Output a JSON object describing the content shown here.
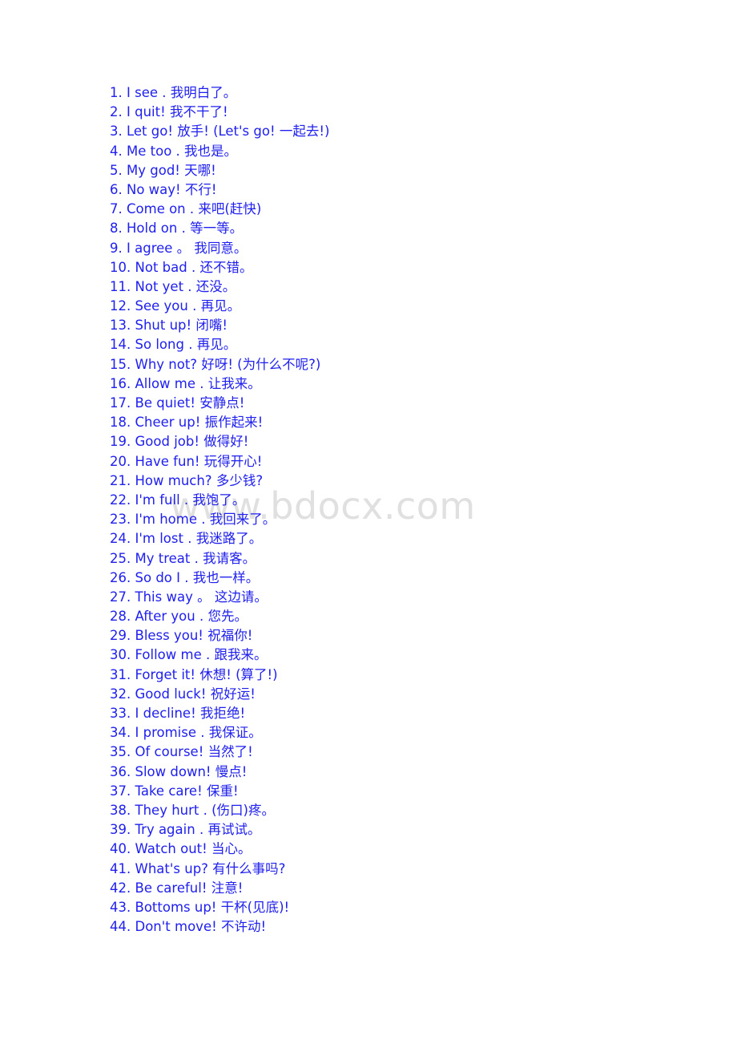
{
  "document": {
    "background_color": "#ffffff",
    "text_color": "#2020ee",
    "watermark": {
      "text": "www.bdocx.com",
      "color": "#e0e0e0"
    }
  },
  "phrases": [
    {
      "num": "1.",
      "en": "I see",
      "sep": ".",
      "zh": "我明白了。"
    },
    {
      "num": "2.",
      "en": "I quit!",
      "sep": "",
      "zh": "我不干了!"
    },
    {
      "num": "3.",
      "en": "Let go!",
      "sep": "",
      "zh": "放手!  (Let's go! 一起去!)"
    },
    {
      "num": "4.",
      "en": "Me too",
      "sep": ".",
      "zh": "我也是。"
    },
    {
      "num": "5.",
      "en": "My god!",
      "sep": "",
      "zh": "天哪!"
    },
    {
      "num": "6.",
      "en": "No way!",
      "sep": "",
      "zh": "不行!"
    },
    {
      "num": "7.",
      "en": "Come on",
      "sep": ".",
      "zh": "来吧(赶快)"
    },
    {
      "num": "8.",
      "en": "Hold on",
      "sep": ".",
      "zh": "等一等。"
    },
    {
      "num": "9.",
      "en": "I agree",
      "sep": "。",
      "zh": "我同意。"
    },
    {
      "num": "10.",
      "en": "Not bad",
      "sep": ".",
      "zh": "还不错。"
    },
    {
      "num": "11.",
      "en": "Not yet",
      "sep": ".",
      "zh": "还没。"
    },
    {
      "num": "12.",
      "en": "See you",
      "sep": ".",
      "zh": "再见。"
    },
    {
      "num": "13.",
      "en": "Shut up!",
      "sep": "",
      "zh": "闭嘴!"
    },
    {
      "num": "14.",
      "en": "So long",
      "sep": ".",
      "zh": "再见。"
    },
    {
      "num": "15.",
      "en": "Why not?",
      "sep": "",
      "zh": "好呀! (为什么不呢?)"
    },
    {
      "num": "16.",
      "en": "Allow me",
      "sep": ".",
      "zh": "让我来。"
    },
    {
      "num": "17.",
      "en": "Be quiet!",
      "sep": "",
      "zh": "安静点!"
    },
    {
      "num": "18.",
      "en": "Cheer up!",
      "sep": "",
      "zh": "振作起来!"
    },
    {
      "num": "19.",
      "en": "Good job!",
      "sep": "",
      "zh": "做得好!"
    },
    {
      "num": "20.",
      "en": "Have fun!",
      "sep": "",
      "zh": "玩得开心!"
    },
    {
      "num": "21.",
      "en": "How much?",
      "sep": "",
      "zh": "多少钱?"
    },
    {
      "num": "22.",
      "en": "I'm full",
      "sep": ".",
      "zh": "我饱了。"
    },
    {
      "num": "23.",
      "en": "I'm home",
      "sep": ".",
      "zh": "我回来了。"
    },
    {
      "num": "24.",
      "en": "I'm lost",
      "sep": ".",
      "zh": "我迷路了。"
    },
    {
      "num": "25.",
      "en": "My treat",
      "sep": ".",
      "zh": "我请客。"
    },
    {
      "num": "26.",
      "en": "So do I",
      "sep": ".",
      "zh": "我也一样。"
    },
    {
      "num": "27.",
      "en": "This way",
      "sep": "。",
      "zh": "这边请。"
    },
    {
      "num": "28.",
      "en": "After you",
      "sep": ".",
      "zh": "您先。"
    },
    {
      "num": "29.",
      "en": "Bless you!",
      "sep": "",
      "zh": "祝福你!"
    },
    {
      "num": "30.",
      "en": "Follow me",
      "sep": ".",
      "zh": "跟我来。"
    },
    {
      "num": "31.",
      "en": "Forget it!",
      "sep": "",
      "zh": "休想! (算了!)"
    },
    {
      "num": "32.",
      "en": "Good luck!",
      "sep": "",
      "zh": "祝好运!"
    },
    {
      "num": "33.",
      "en": "I decline!",
      "sep": "",
      "zh": "我拒绝!"
    },
    {
      "num": "34.",
      "en": "I promise",
      "sep": ".",
      "zh": "我保证。"
    },
    {
      "num": "35.",
      "en": "Of course!",
      "sep": "",
      "zh": "当然了!"
    },
    {
      "num": "36.",
      "en": "Slow down!",
      "sep": "",
      "zh": "慢点!"
    },
    {
      "num": "37.",
      "en": "Take care!",
      "sep": "",
      "zh": "保重!"
    },
    {
      "num": "38.",
      "en": "They hurt",
      "sep": ".",
      "zh": "(伤口)疼。"
    },
    {
      "num": "39.",
      "en": "Try again",
      "sep": ".",
      "zh": "再试试。"
    },
    {
      "num": "40.",
      "en": "Watch out!",
      "sep": "",
      "zh": "当心。"
    },
    {
      "num": "41.",
      "en": "What's up?",
      "sep": "",
      "zh": "有什么事吗?"
    },
    {
      "num": "42.",
      "en": "Be careful!",
      "sep": "",
      "zh": "注意!"
    },
    {
      "num": "43.",
      "en": "Bottoms up!",
      "sep": "",
      "zh": "干杯(见底)!"
    },
    {
      "num": "44.",
      "en": "Don't move!",
      "sep": "",
      "zh": "不许动!"
    }
  ]
}
